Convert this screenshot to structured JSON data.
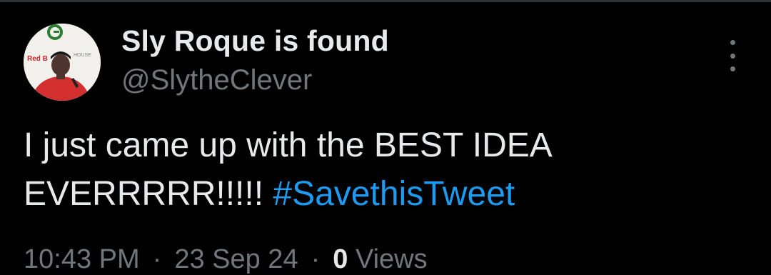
{
  "tweet": {
    "author": {
      "display_name": "Sly Roque is found",
      "handle": "@SlytheClever",
      "avatar_icon": "profile-photo"
    },
    "text": "I just came up with the BEST IDEA EVERRRRR!!!!!",
    "text_lines": [
      "I just came up with the BEST IDEA",
      "EVERRRRR!!!!!"
    ],
    "hashtag": "#SavethisTweet",
    "more_icon": "vertical-ellipsis-icon",
    "meta": {
      "time": "10:43 PM",
      "date": "23 Sep 24",
      "views_count": "0",
      "views_label": "Views",
      "separator": "·"
    }
  },
  "colors": {
    "background": "#000000",
    "text_primary": "#e7e9ea",
    "text_secondary": "#71767b",
    "link": "#1d9bf0",
    "divider": "#2f3336"
  }
}
